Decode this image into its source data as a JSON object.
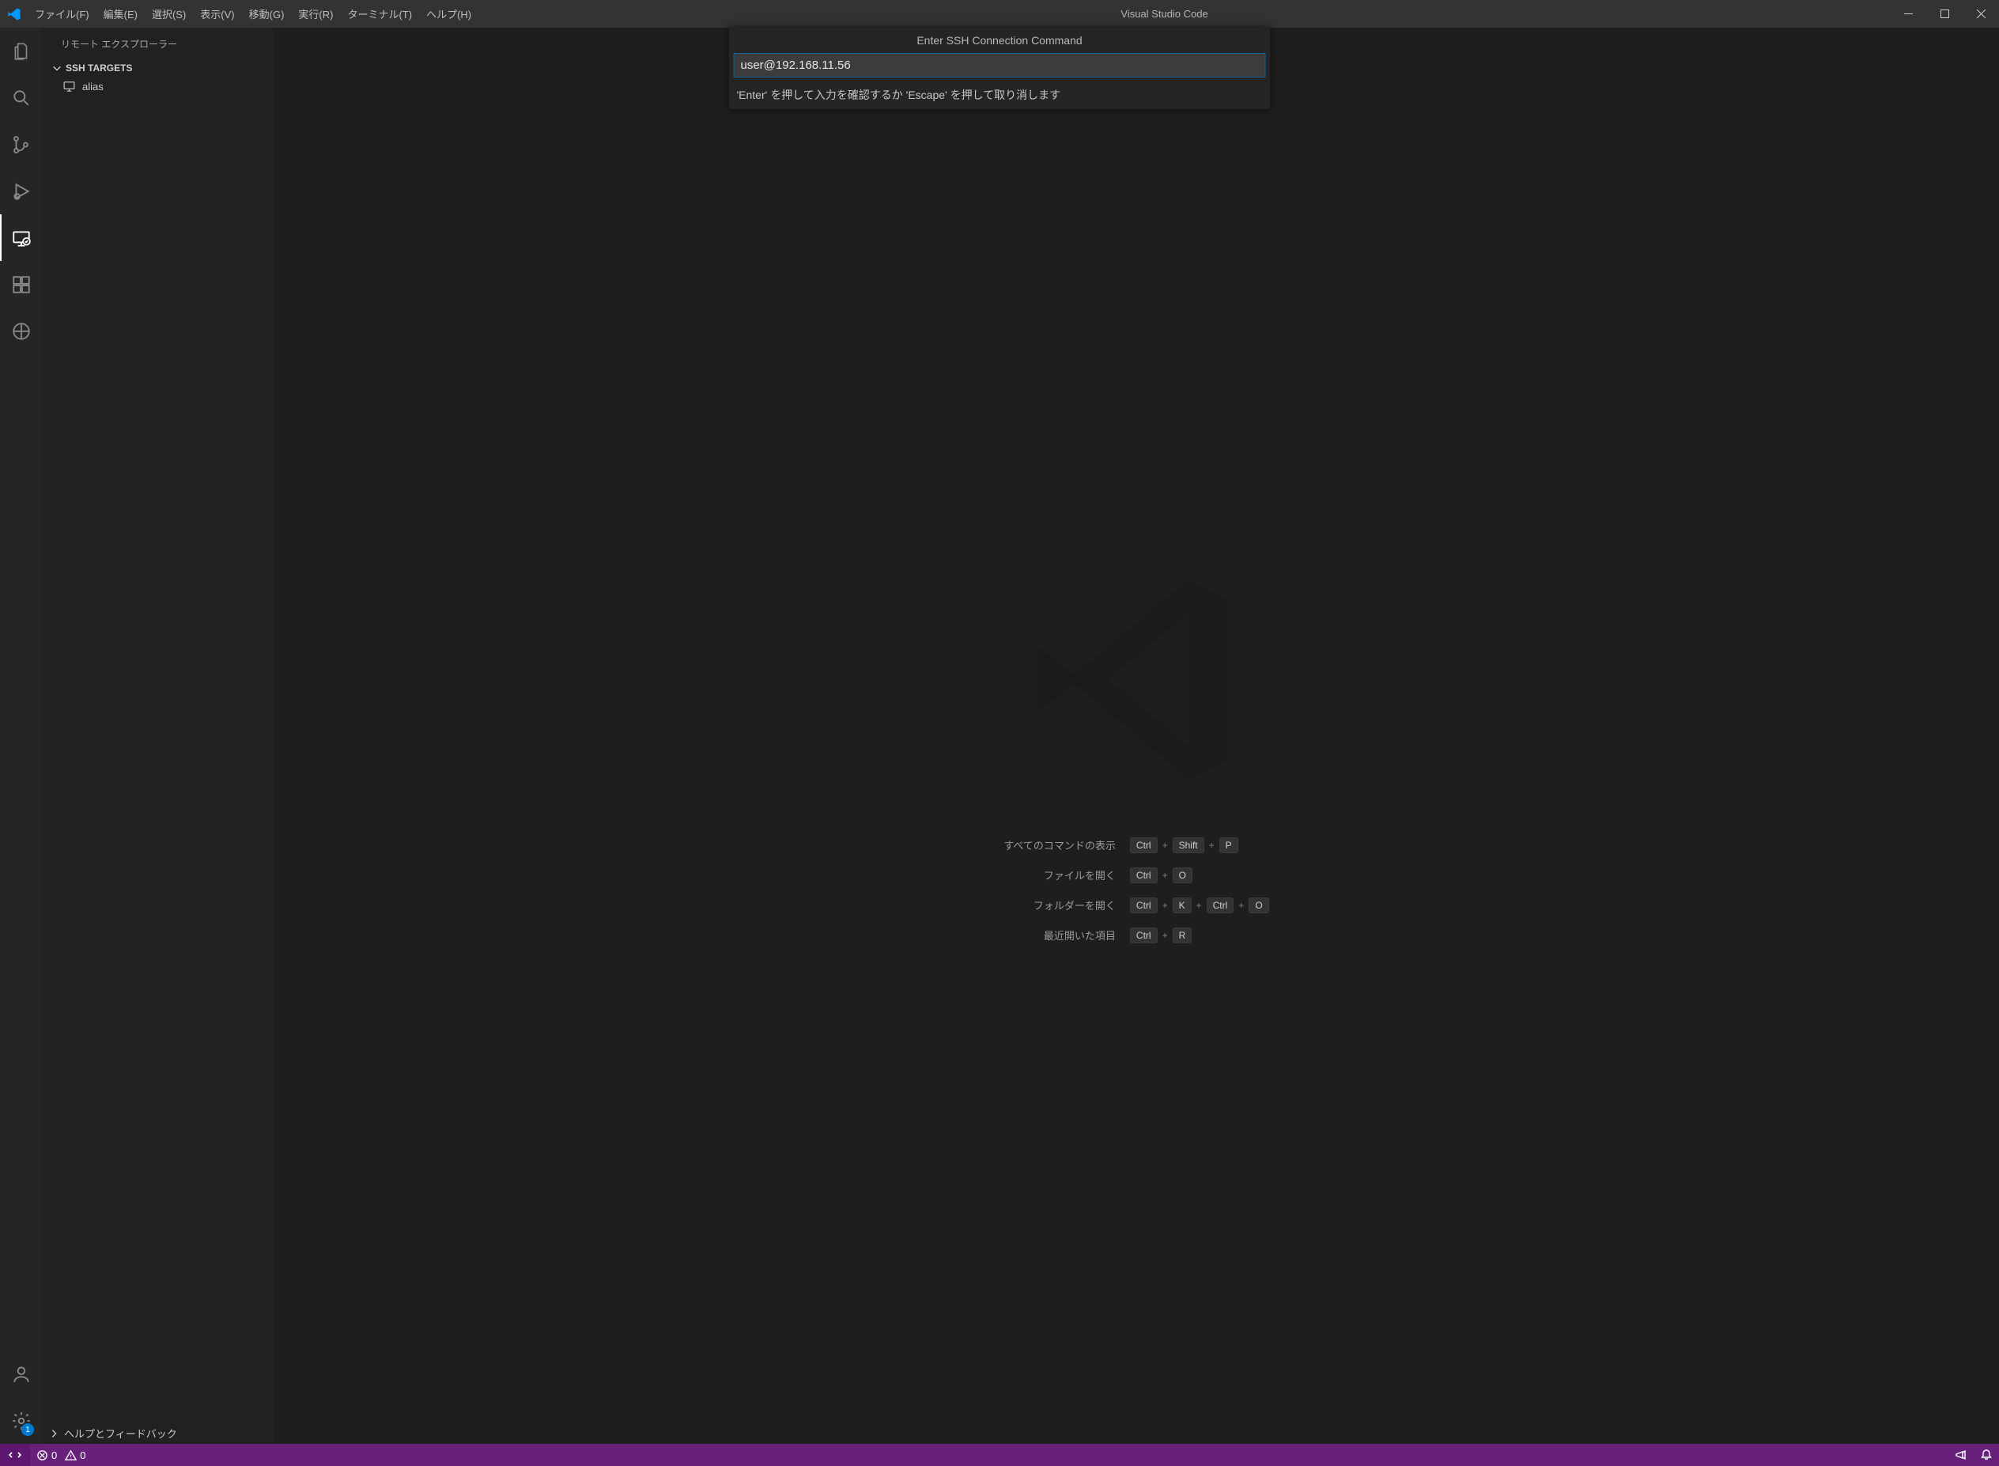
{
  "window": {
    "title": "Visual Studio Code"
  },
  "menu": {
    "file": "ファイル(F)",
    "edit": "編集(E)",
    "select": "選択(S)",
    "view": "表示(V)",
    "go": "移動(G)",
    "run": "実行(R)",
    "terminal": "ターミナル(T)",
    "help": "ヘルプ(H)"
  },
  "sidebar": {
    "header": "リモート エクスプローラー",
    "section": "SSH TARGETS",
    "targets": [
      {
        "label": "alias"
      }
    ],
    "footer": "ヘルプとフィードバック"
  },
  "activity": {
    "settings_badge": "1"
  },
  "quickInput": {
    "title": "Enter SSH Connection Command",
    "value": "user@192.168.11.56",
    "hint": "'Enter' を押して入力を確認するか 'Escape' を押して取り消します"
  },
  "welcome": {
    "rows": [
      {
        "label": "すべてのコマンドの表示",
        "keys": [
          "Ctrl",
          "Shift",
          "P"
        ]
      },
      {
        "label": "ファイルを開く",
        "keys": [
          "Ctrl",
          "O"
        ]
      },
      {
        "label": "フォルダーを開く",
        "keys": [
          "Ctrl",
          "K",
          "Ctrl",
          "O"
        ]
      },
      {
        "label": "最近開いた項目",
        "keys": [
          "Ctrl",
          "R"
        ]
      }
    ]
  },
  "status": {
    "errors": "0",
    "warnings": "0"
  }
}
